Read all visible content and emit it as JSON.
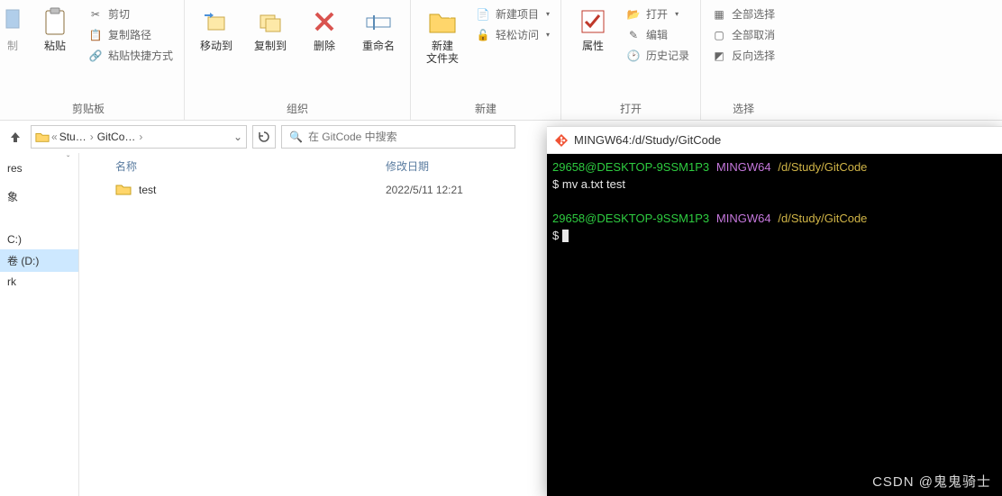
{
  "ribbon": {
    "clipboard": {
      "copy2": "粘贴",
      "del_lbl": "制",
      "cut": "剪切",
      "copy_path": "复制路径",
      "paste_shortcut": "粘贴快捷方式",
      "group": "剪贴板"
    },
    "organize": {
      "move_to": "移动到",
      "copy_to": "复制到",
      "delete": "删除",
      "rename": "重命名",
      "group": "组织"
    },
    "new": {
      "new_folder": "新建\n文件夹",
      "new_item": "新建项目",
      "easy_access": "轻松访问",
      "group": "新建"
    },
    "open": {
      "properties": "属性",
      "open": "打开",
      "edit": "编辑",
      "history": "历史记录",
      "group": "打开"
    },
    "select": {
      "select_all": "全部选择",
      "select_none": "全部取消",
      "invert": "反向选择",
      "group": "选择"
    }
  },
  "breadcrumb": {
    "p1": "Stu…",
    "p2": "GitCo…",
    "search_placeholder": "在 GitCode 中搜索"
  },
  "sidebar": {
    "items": [
      "res",
      "",
      "象",
      "",
      "",
      "",
      "C:)",
      "卷 (D:)",
      "rk"
    ]
  },
  "columns": {
    "name": "名称",
    "date": "修改日期"
  },
  "files": [
    {
      "name": "test",
      "date": "2022/5/11 12:21",
      "type": "folder"
    }
  ],
  "terminal": {
    "title": "MINGW64:/d/Study/GitCode",
    "user": "29658@DESKTOP-9SSM1P3",
    "env": "MINGW64",
    "path": "/d/Study/GitCode",
    "cmd1": "mv a.txt test",
    "prompt": "$"
  },
  "watermark": "CSDN @鬼鬼骑士"
}
